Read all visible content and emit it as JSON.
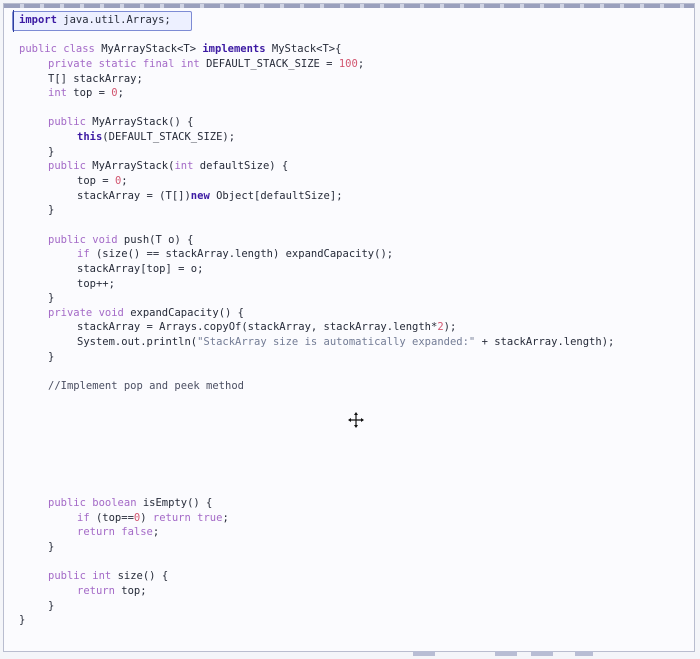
{
  "editor": {
    "name": "code-editor",
    "lines": [
      [
        {
          "t": "import",
          "s": "kw"
        },
        {
          "t": " java.util.Arrays;",
          "s": "normal"
        }
      ],
      [],
      [
        {
          "t": "public ",
          "s": "mod"
        },
        {
          "t": "class ",
          "s": "mod"
        },
        {
          "t": "MyArrayStack<T> ",
          "s": "normal"
        },
        {
          "t": "implements ",
          "s": "kw"
        },
        {
          "t": "MyStack<T>{",
          "s": "normal"
        }
      ],
      [
        {
          "t": "private ",
          "s": "mod"
        },
        {
          "t": "static ",
          "s": "mod"
        },
        {
          "t": "final ",
          "s": "mod"
        },
        {
          "t": "int ",
          "s": "mod"
        },
        {
          "t": "DEFAULT_STACK_SIZE = ",
          "s": "normal"
        },
        {
          "t": "100",
          "s": "num"
        },
        {
          "t": ";",
          "s": "normal"
        }
      ],
      [
        {
          "t": "T[] stackArray;",
          "s": "normal"
        }
      ],
      [
        {
          "t": "int ",
          "s": "mod"
        },
        {
          "t": "top = ",
          "s": "normal"
        },
        {
          "t": "0",
          "s": "num"
        },
        {
          "t": ";",
          "s": "normal"
        }
      ],
      [],
      [
        {
          "t": "public ",
          "s": "mod"
        },
        {
          "t": "MyArrayStack() {",
          "s": "normal"
        }
      ],
      [
        {
          "t": "this",
          "s": "kw"
        },
        {
          "t": "(DEFAULT_STACK_SIZE);",
          "s": "normal"
        }
      ],
      [
        {
          "t": "}",
          "s": "normal"
        }
      ],
      [
        {
          "t": "public ",
          "s": "mod"
        },
        {
          "t": "MyArrayStack(",
          "s": "normal"
        },
        {
          "t": "int ",
          "s": "mod"
        },
        {
          "t": "defaultSize) {",
          "s": "normal"
        }
      ],
      [
        {
          "t": "top = ",
          "s": "normal"
        },
        {
          "t": "0",
          "s": "num"
        },
        {
          "t": ";",
          "s": "normal"
        }
      ],
      [
        {
          "t": "stackArray = (T[])",
          "s": "normal"
        },
        {
          "t": "new ",
          "s": "kw"
        },
        {
          "t": "Object[defaultSize];",
          "s": "normal"
        }
      ],
      [
        {
          "t": "}",
          "s": "normal"
        }
      ],
      [],
      [
        {
          "t": "public ",
          "s": "mod"
        },
        {
          "t": "void ",
          "s": "mod"
        },
        {
          "t": "push(T o) {",
          "s": "normal"
        }
      ],
      [
        {
          "t": "if ",
          "s": "mod"
        },
        {
          "t": "(size() == stackArray.length) expandCapacity();",
          "s": "normal"
        }
      ],
      [
        {
          "t": "stackArray[top] = o;",
          "s": "normal"
        }
      ],
      [
        {
          "t": "top++;",
          "s": "normal"
        }
      ],
      [
        {
          "t": "}",
          "s": "normal"
        }
      ],
      [
        {
          "t": "private ",
          "s": "mod"
        },
        {
          "t": "void ",
          "s": "mod"
        },
        {
          "t": "expandCapacity() {",
          "s": "normal"
        }
      ],
      [
        {
          "t": "stackArray = Arrays.copyOf(stackArray, stackArray.length*",
          "s": "normal"
        },
        {
          "t": "2",
          "s": "num"
        },
        {
          "t": ");",
          "s": "normal"
        }
      ],
      [
        {
          "t": "System.out.println(",
          "s": "normal"
        },
        {
          "t": "\"StackArray size is automatically expanded:\"",
          "s": "str"
        },
        {
          "t": " + stackArray.length);",
          "s": "normal"
        }
      ],
      [
        {
          "t": "}",
          "s": "normal"
        }
      ],
      [],
      [
        {
          "t": "//Implement pop and peek method",
          "s": "cmt"
        }
      ],
      [],
      [],
      [],
      [],
      [],
      [],
      [],
      [
        {
          "t": "public ",
          "s": "mod"
        },
        {
          "t": "boolean ",
          "s": "mod"
        },
        {
          "t": "isEmpty() {",
          "s": "normal"
        }
      ],
      [
        {
          "t": "if ",
          "s": "mod"
        },
        {
          "t": "(top==",
          "s": "normal"
        },
        {
          "t": "0",
          "s": "num"
        },
        {
          "t": ") ",
          "s": "normal"
        },
        {
          "t": "return ",
          "s": "mod"
        },
        {
          "t": "true",
          "s": "mod"
        },
        {
          "t": ";",
          "s": "normal"
        }
      ],
      [
        {
          "t": "return ",
          "s": "mod"
        },
        {
          "t": "false",
          "s": "mod"
        },
        {
          "t": ";",
          "s": "normal"
        }
      ],
      [
        {
          "t": "}",
          "s": "normal"
        }
      ],
      [],
      [
        {
          "t": "public ",
          "s": "mod"
        },
        {
          "t": "int ",
          "s": "mod"
        },
        {
          "t": "size() {",
          "s": "normal"
        }
      ],
      [
        {
          "t": "return ",
          "s": "mod"
        },
        {
          "t": "top;",
          "s": "normal"
        }
      ],
      [
        {
          "t": "}",
          "s": "normal"
        }
      ],
      [
        {
          "t": "}",
          "s": "normal"
        }
      ]
    ],
    "indent": [
      0,
      0,
      0,
      1,
      1,
      1,
      0,
      1,
      2,
      1,
      1,
      2,
      2,
      1,
      0,
      1,
      2,
      2,
      2,
      1,
      1,
      2,
      2,
      1,
      0,
      1,
      0,
      0,
      0,
      0,
      0,
      0,
      0,
      1,
      2,
      2,
      1,
      0,
      1,
      2,
      1,
      0
    ],
    "cursor_icon": "move-cursor-icon"
  }
}
